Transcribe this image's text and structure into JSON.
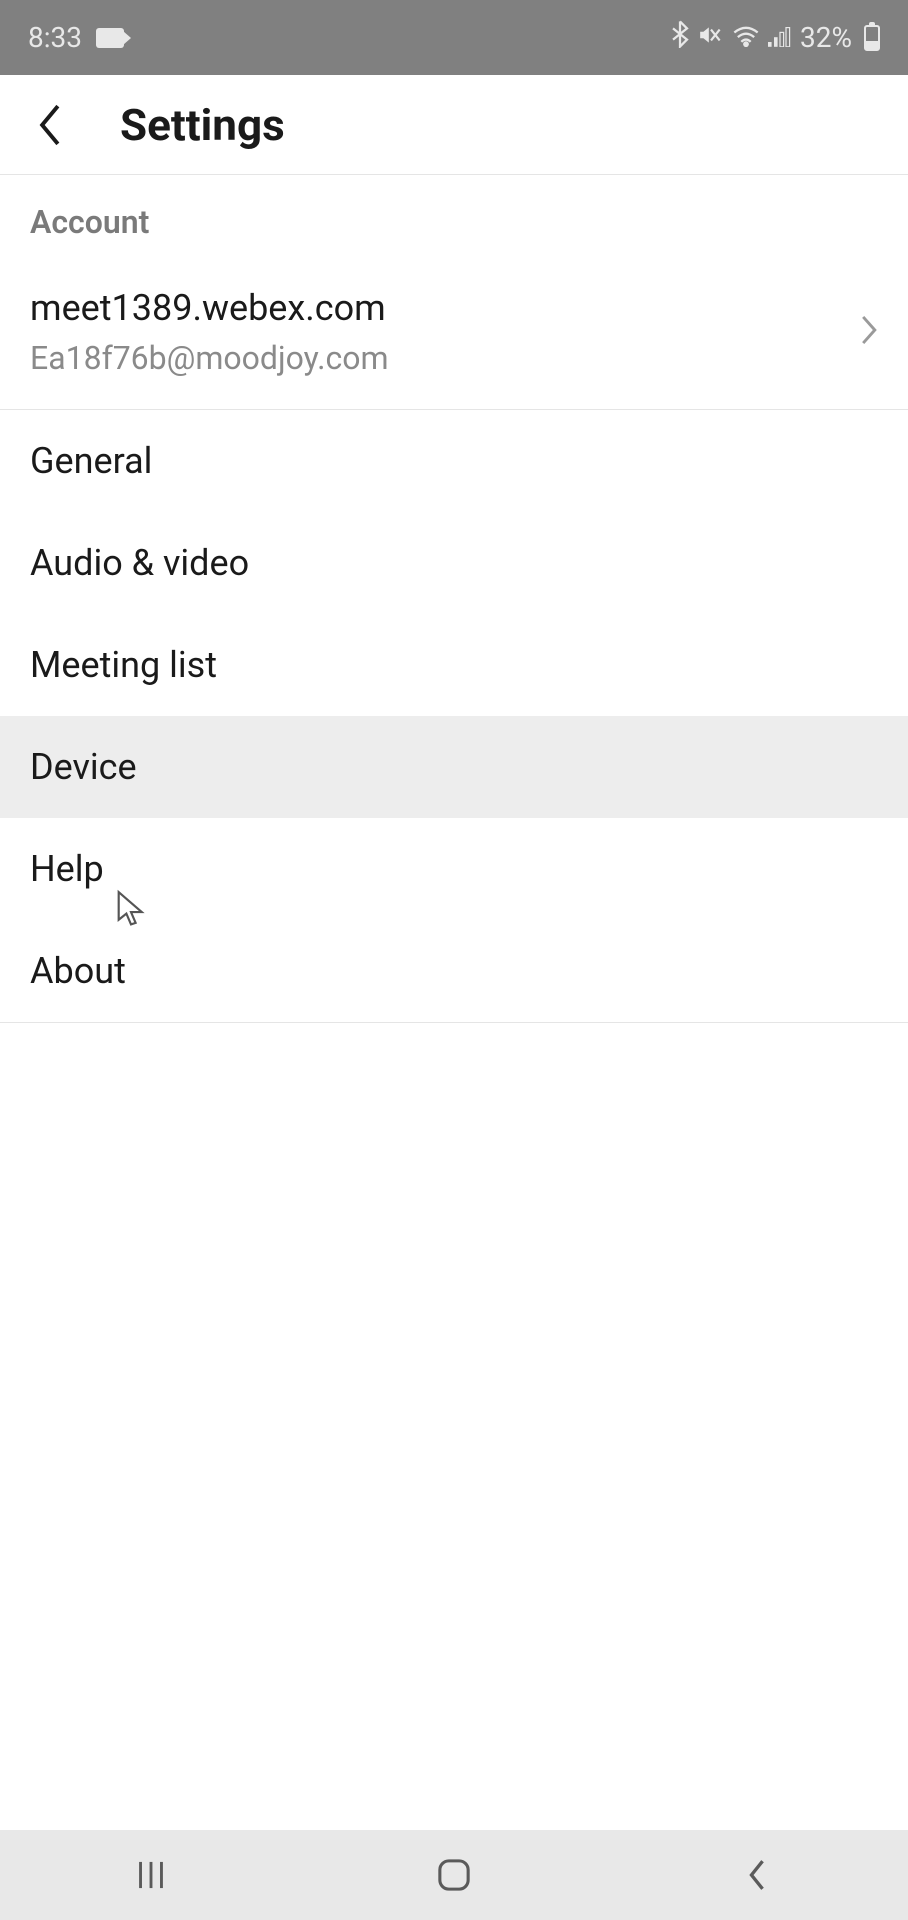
{
  "status": {
    "time": "8:33",
    "battery_percent": "32%"
  },
  "header": {
    "title": "Settings"
  },
  "account": {
    "section_label": "Account",
    "site": "meet1389.webex.com",
    "email": "Ea18f76b@moodjoy.com"
  },
  "menu": {
    "items": [
      {
        "label": "General"
      },
      {
        "label": "Audio & video"
      },
      {
        "label": "Meeting list"
      },
      {
        "label": "Device"
      },
      {
        "label": "Help"
      },
      {
        "label": "About"
      }
    ]
  }
}
